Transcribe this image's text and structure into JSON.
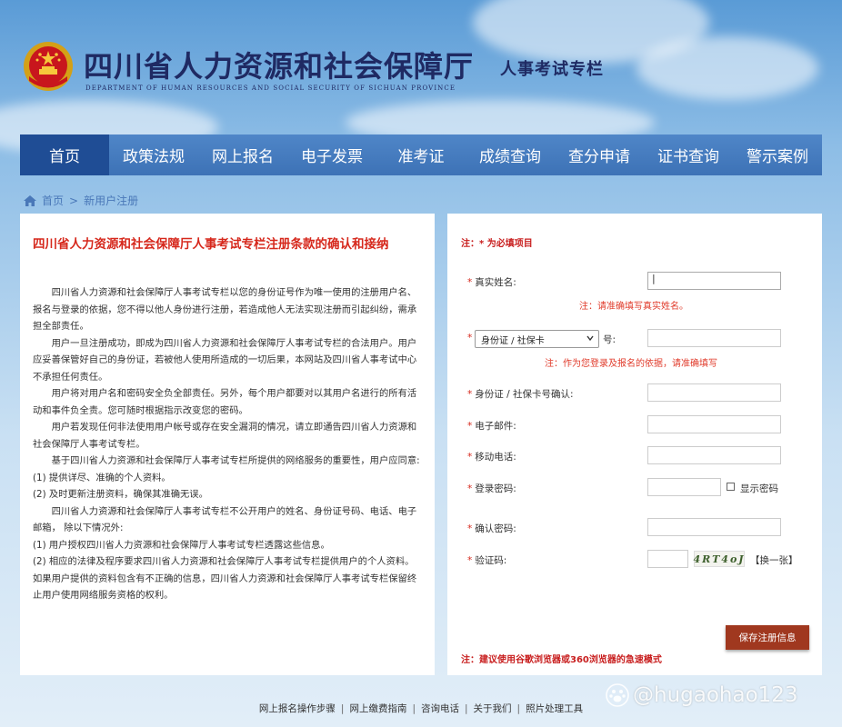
{
  "header": {
    "title": "四川省人力资源和社会保障厅",
    "subtitle": "DEPARTMENT OF HUMAN RESOURCES AND SOCIAL SECURITY OF SICHUAN PROVINCE",
    "column_title": "人事考试专栏",
    "emblem_icon": "national-emblem-icon"
  },
  "nav": {
    "items": [
      "首页",
      "政策法规",
      "网上报名",
      "电子发票",
      "准考证",
      "成绩查询",
      "查分申请",
      "证书查询",
      "警示案例"
    ],
    "active_index": 0
  },
  "breadcrumb": {
    "home": "首页",
    "separator": ">",
    "current": "新用户注册"
  },
  "terms": {
    "title": "四川省人力资源和社会保障厅人事考试专栏注册条款的确认和接纳",
    "paragraphs": [
      {
        "text": "四川省人力资源和社会保障厅人事考试专栏以您的身份证号作为唯一使用的注册用户名、报名与登录的依据，您不得以他人身份进行注册，若造成他人无法实现注册而引起纠纷，需承担全部责任。",
        "indent": true
      },
      {
        "text": "用户一旦注册成功，即成为四川省人力资源和社会保障厅人事考试专栏的合法用户。用户应妥善保管好自己的身份证，若被他人使用所造成的一切后果，本网站及四川省人事考试中心不承担任何责任。",
        "indent": true
      },
      {
        "text": "用户将对用户名和密码安全负全部责任。另外，每个用户都要对以其用户名进行的所有活动和事件负全责。您可随时根据指示改变您的密码。",
        "indent": true
      },
      {
        "text": "用户若发现任何非法使用用户帐号或存在安全漏洞的情况，请立即通告四川省人力资源和社会保障厅人事考试专栏。",
        "indent": true
      },
      {
        "text": "基于四川省人力资源和社会保障厅人事考试专栏所提供的网络服务的重要性，用户应同意:",
        "indent": true
      },
      {
        "text": "(1) 提供详尽、准确的个人资料。",
        "indent": false
      },
      {
        "text": "(2) 及时更新注册资料，确保其准确无误。",
        "indent": false
      },
      {
        "text": "四川省人力资源和社会保障厅人事考试专栏不公开用户的姓名、身份证号码、电话、电子邮箱，  除以下情况外:",
        "indent": true
      },
      {
        "text": "(1) 用户授权四川省人力资源和社会保障厅人事考试专栏透露这些信息。",
        "indent": false
      },
      {
        "text": "(2) 相应的法律及程序要求四川省人力资源和社会保障厅人事考试专栏提供用户的个人资料。如果用户提供的资料包含有不正确的信息，四川省人力资源和社会保障厅人事考试专栏保留终止用户使用网络服务资格的权利。",
        "indent": false
      }
    ]
  },
  "form": {
    "note_top": "注：* 为必填项目",
    "required_mark": "*",
    "real_name_label": "真实姓名:",
    "real_name_value": "",
    "real_name_hint": "注：请准确填写真实姓名。",
    "id_type_selected": "身份证 / 社保卡",
    "id_number_suffix": "号:",
    "id_hint": "注：作为您登录及报名的依据，请准确填写",
    "id_confirm_label": "身份证 / 社保卡号确认:",
    "email_label": "电子邮件:",
    "phone_label": "移动电话:",
    "password_label": "登录密码:",
    "show_password_label": "显示密码",
    "show_password_checked": false,
    "confirm_password_label": "确认密码:",
    "captcha_label": "验证码:",
    "captcha_text": "4RT4oJ",
    "change_captcha": "【换一张】",
    "submit_label": "保存注册信息",
    "note_bottom": "注：建议使用谷歌浏览器或360浏览器的急速模式"
  },
  "footer": {
    "links": [
      "网上报名操作步骤",
      "网上缴费指南",
      "咨询电话",
      "关于我们",
      "照片处理工具"
    ],
    "separator": "|"
  },
  "watermark": {
    "text": "@hugaohao123",
    "icon": "baidu-paw-icon"
  },
  "colors": {
    "nav_bg": "#4278bb",
    "nav_active": "#1f4d95",
    "title_red": "#d6281c",
    "button_bg": "#a0381f",
    "header_text": "#1f2a63"
  }
}
